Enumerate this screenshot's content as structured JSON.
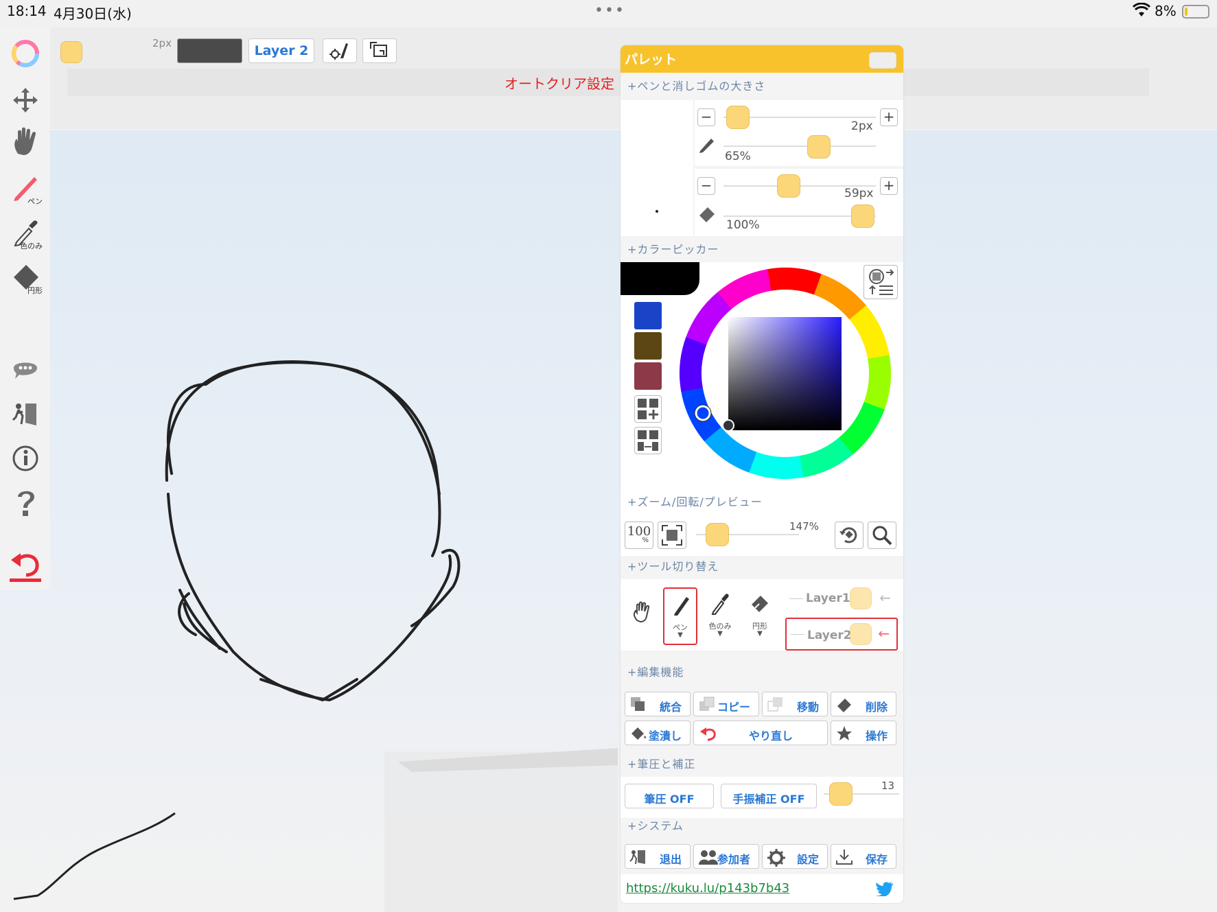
{
  "status_bar": {
    "time": "18:14",
    "date": "4月30日(水)",
    "battery": "8%"
  },
  "top_toolbar": {
    "brush_size": "2px",
    "layer_button": "Layer 2",
    "auto_clear": "オートクリア設定"
  },
  "sidebar": {
    "pen_label": "ペン",
    "color_only_label": "色のみ",
    "circle_label": "円形"
  },
  "palette": {
    "title": "パレット",
    "sections": {
      "pen_eraser_size": "+ペンと消しゴムの大きさ",
      "color_picker": "+カラーピッカー",
      "zoom": "+ズーム/回転/プレビュー",
      "tool_switch": "+ツール切り替え",
      "edit": "+編集機能",
      "pressure": "+筆圧と補正",
      "system": "+システム"
    },
    "pen_size": "2px",
    "pen_opacity": "65%",
    "eraser_size": "59px",
    "eraser_opacity": "100%",
    "swatches": [
      "#1a44c8",
      "#5c4714",
      "#8c3a48"
    ],
    "zoom_reset_label": "100",
    "zoom_reset_sub": "%",
    "zoom_value": "147%",
    "tools": {
      "pen": "ペン",
      "color_only": "色のみ",
      "circle": "円形"
    },
    "layers": [
      "Layer1",
      "Layer2"
    ],
    "edit_buttons": {
      "merge": "統合",
      "copy": "コピー",
      "move": "移動",
      "delete": "削除",
      "fill": "塗潰し",
      "redo": "やり直し",
      "operation": "操作"
    },
    "pressure_off": "筆圧 OFF",
    "stabilizer_off": "手振補正 OFF",
    "stabilizer_value": "13",
    "system_buttons": {
      "exit": "退出",
      "participants": "参加者",
      "settings": "設定",
      "save": "保存"
    },
    "url": "https://kuku.lu/p143b7b43"
  }
}
